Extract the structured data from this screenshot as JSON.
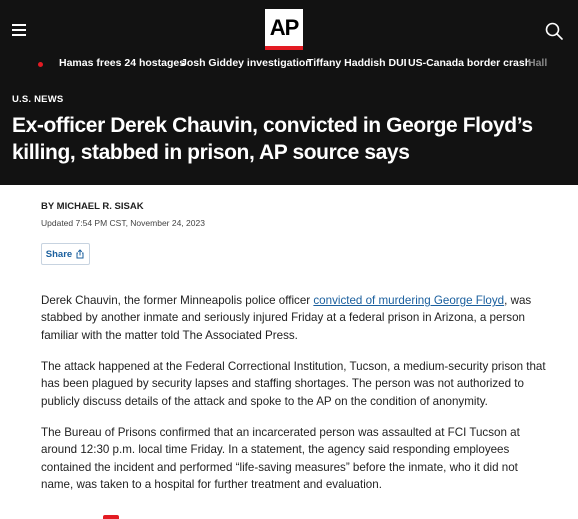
{
  "header": {
    "logo_text": "AP",
    "menu_icon": "hamburger-menu-icon",
    "search_icon": "search-icon",
    "brand_color": "#e31b23",
    "background_color": "#121212"
  },
  "trending": {
    "items": [
      "Hamas frees 24 hostages",
      "Josh Giddey investigation",
      "Tiffany Haddish DUI",
      "US-Canada border crash",
      "Hall"
    ]
  },
  "article": {
    "section": "U.S. NEWS",
    "headline": "Ex-officer Derek Chauvin, convicted in George Floyd’s killing, stabbed in prison, AP source says",
    "byline": "BY MICHAEL R. SISAK",
    "updated": "Updated 7:54 PM CST, November 24, 2023",
    "share_label": "Share",
    "paragraphs": {
      "p1_before": "Derek Chauvin, the former Minneapolis police officer ",
      "p1_link": "convicted of murdering George Floyd",
      "p1_after": ", was stabbed by another inmate and seriously injured Friday at a federal prison in Arizona, a person familiar with the matter told The Associated Press.",
      "p2": "The attack happened at the Federal Correctional Institution, Tucson, a medium-security prison that has been plagued by security lapses and staffing shortages. The person was not authorized to publicly discuss details of the attack and spoke to the AP on the condition of anonymity.",
      "p3": "The Bureau of Prisons confirmed that an incarcerated person was assaulted at FCI Tucson at around 12:30 p.m. local time Friday. In a statement, the agency said responding employees contained the incident and performed “life-saving measures” before the inmate, who it did not name, was taken to a hospital for further treatment and evaluation."
    },
    "link_color": "#1a5f9e"
  }
}
